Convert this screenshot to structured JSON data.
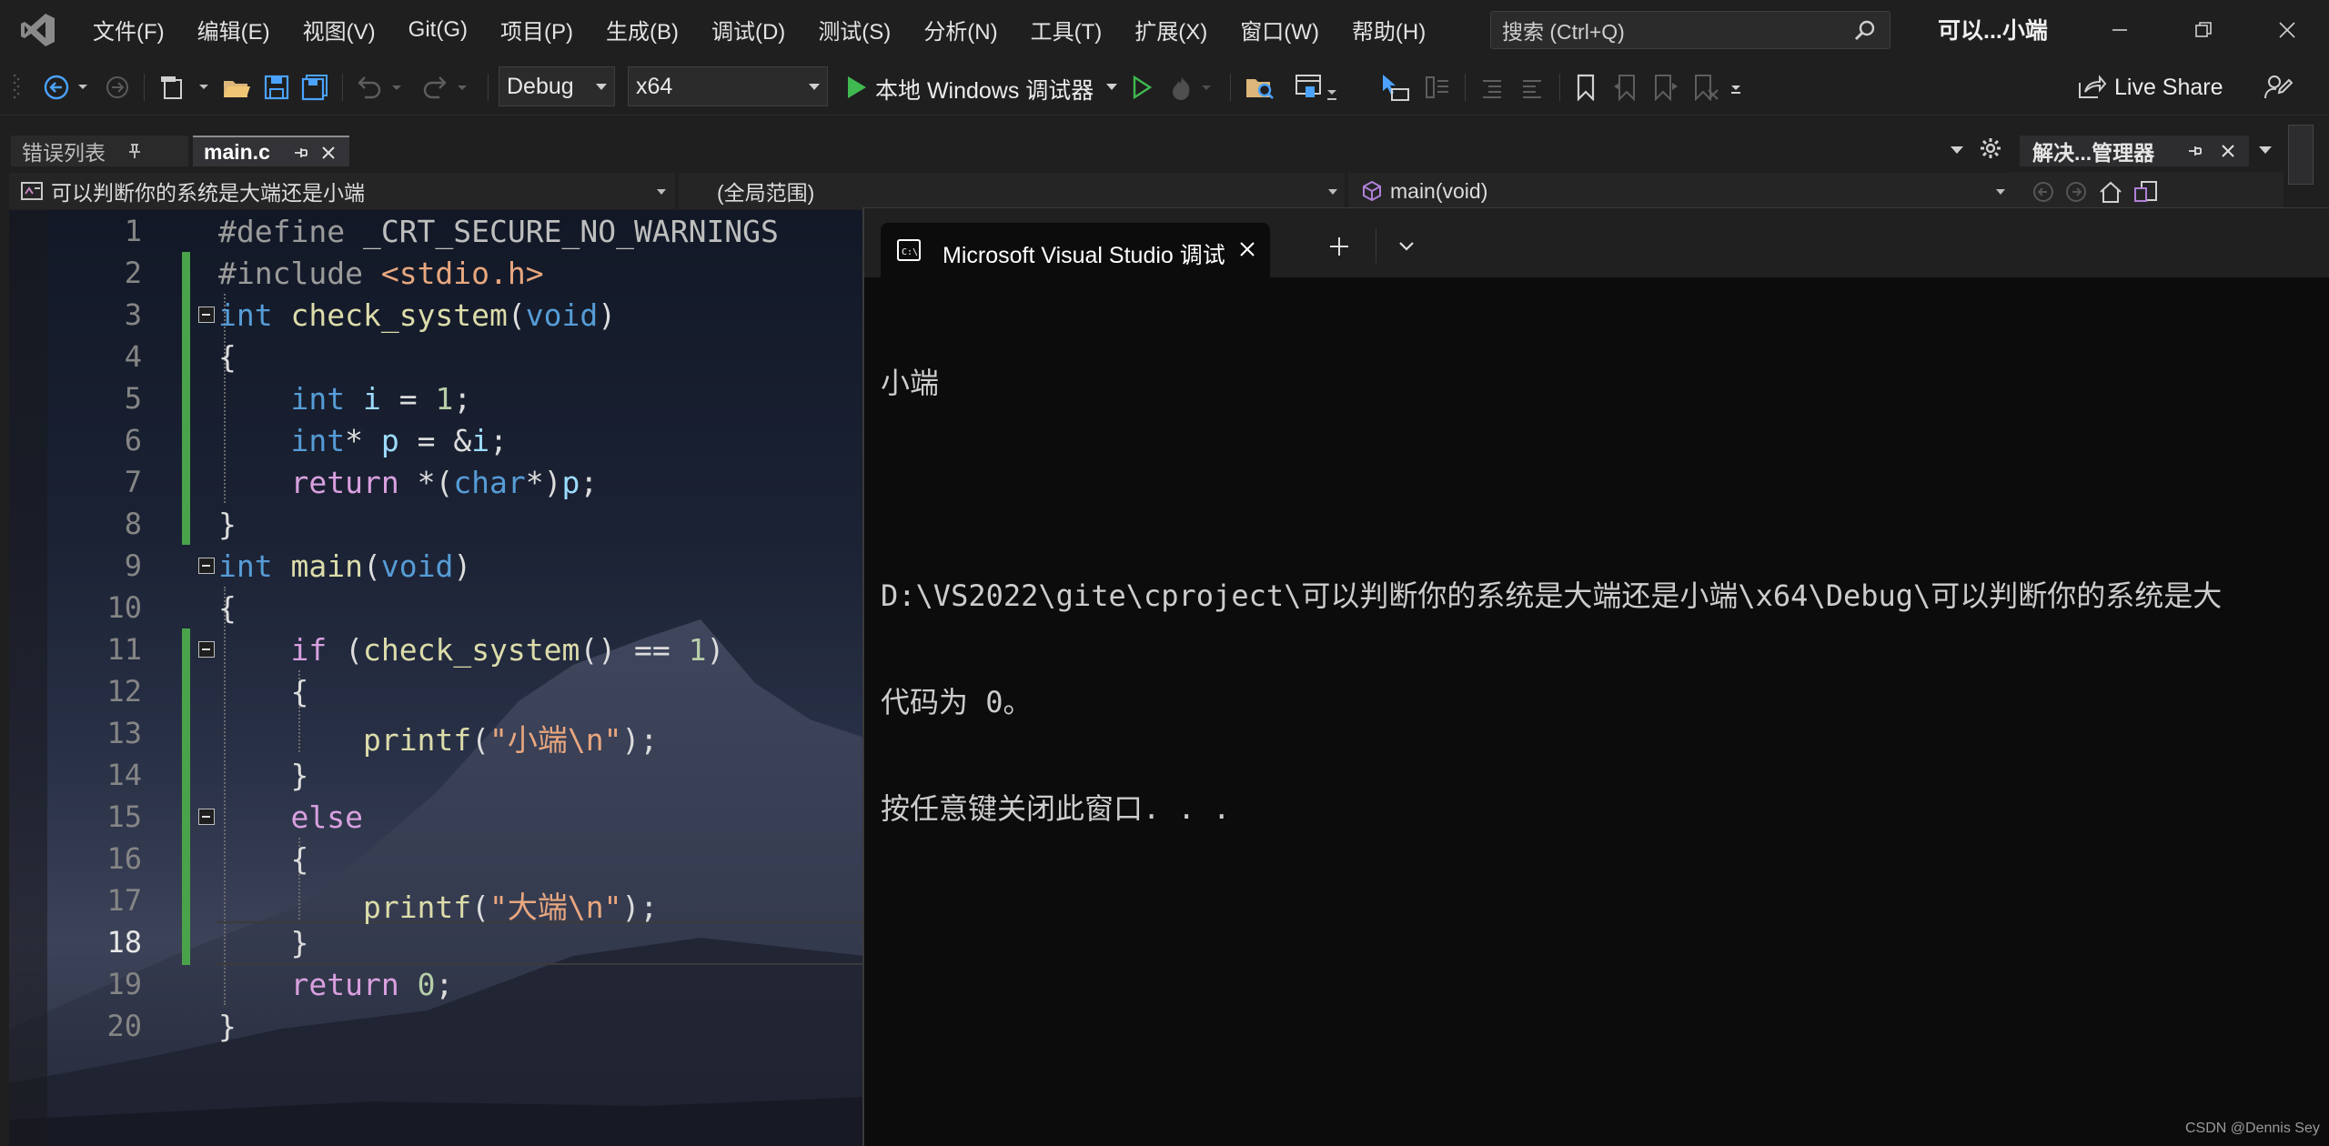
{
  "menubar": {
    "items": [
      "文件(F)",
      "编辑(E)",
      "视图(V)",
      "Git(G)",
      "项目(P)",
      "生成(B)",
      "调试(D)",
      "测试(S)",
      "分析(N)",
      "工具(T)",
      "扩展(X)",
      "窗口(W)",
      "帮助(H)"
    ],
    "search_placeholder": "搜索 (Ctrl+Q)",
    "window_title": "可以...小端"
  },
  "toolbar": {
    "config": "Debug",
    "platform": "x64",
    "run_label": "本地 Windows 调试器",
    "live_share": "Live Share"
  },
  "tabs": {
    "error_list": "错误列表",
    "active_file": "main.c",
    "solution_explorer": "解决...管理器"
  },
  "navbar": {
    "project": "可以判断你的系统是大端还是小端",
    "scope": "(全局范围)",
    "member": "main(void)"
  },
  "editor": {
    "line_numbers": [
      "1",
      "2",
      "3",
      "4",
      "5",
      "6",
      "7",
      "8",
      "9",
      "10",
      "11",
      "12",
      "13",
      "14",
      "15",
      "16",
      "17",
      "18",
      "19",
      "20"
    ],
    "current_line": "18"
  },
  "terminal": {
    "tab_title": "Microsoft Visual Studio 调试",
    "lines": [
      "小端",
      "",
      "D:\\VS2022\\gite\\cproject\\可以判断你的系统是大端还是小端\\x64\\Debug\\可以判断你的系统是大",
      "代码为 0。",
      "按任意键关闭此窗口. . ."
    ]
  },
  "watermark": "CSDN @Dennis Sey"
}
